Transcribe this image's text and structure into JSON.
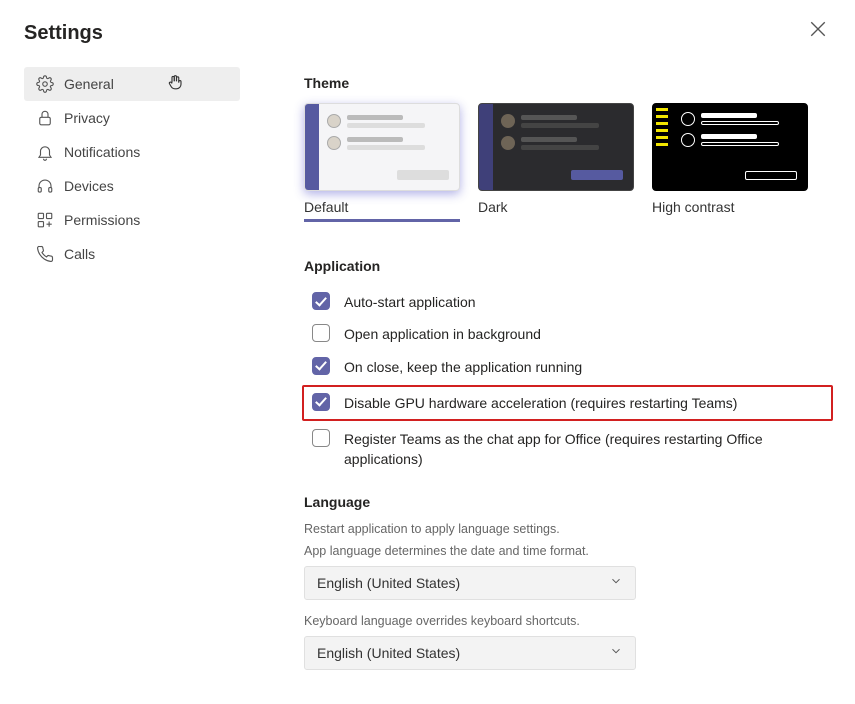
{
  "title": "Settings",
  "sidebar": {
    "items": [
      {
        "label": "General",
        "icon": "gear-icon",
        "active": true
      },
      {
        "label": "Privacy",
        "icon": "lock-icon",
        "active": false
      },
      {
        "label": "Notifications",
        "icon": "bell-icon",
        "active": false
      },
      {
        "label": "Devices",
        "icon": "headset-icon",
        "active": false
      },
      {
        "label": "Permissions",
        "icon": "apps-icon",
        "active": false
      },
      {
        "label": "Calls",
        "icon": "phone-icon",
        "active": false
      }
    ]
  },
  "theme": {
    "title": "Theme",
    "options": [
      {
        "label": "Default",
        "selected": true
      },
      {
        "label": "Dark",
        "selected": false
      },
      {
        "label": "High contrast",
        "selected": false
      }
    ]
  },
  "application": {
    "title": "Application",
    "options": [
      {
        "label": "Auto-start application",
        "checked": true,
        "highlighted": false
      },
      {
        "label": "Open application in background",
        "checked": false,
        "highlighted": false
      },
      {
        "label": "On close, keep the application running",
        "checked": true,
        "highlighted": false
      },
      {
        "label": "Disable GPU hardware acceleration (requires restarting Teams)",
        "checked": true,
        "highlighted": true
      },
      {
        "label": "Register Teams as the chat app for Office (requires restarting Office applications)",
        "checked": false,
        "highlighted": false
      }
    ]
  },
  "language": {
    "title": "Language",
    "restart_hint": "Restart application to apply language settings.",
    "app_lang_hint": "App language determines the date and time format.",
    "app_lang_value": "English (United States)",
    "kb_lang_hint": "Keyboard language overrides keyboard shortcuts.",
    "kb_lang_value": "English (United States)"
  }
}
